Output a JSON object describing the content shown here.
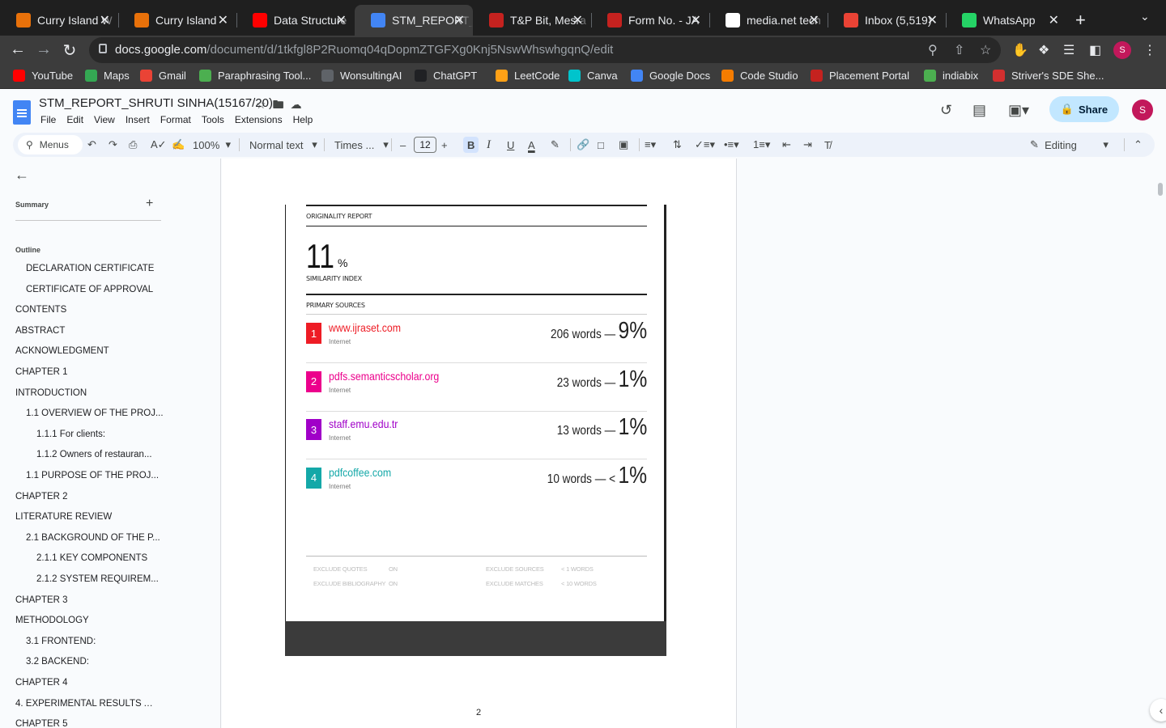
{
  "browser": {
    "tabs": [
      {
        "title": "Curry Island W",
        "favicon": "curry-icon",
        "color": "#e8710a",
        "active": false
      },
      {
        "title": "Curry Island",
        "favicon": "curry-icon",
        "color": "#e8710a",
        "active": false
      },
      {
        "title": "Data Structure",
        "favicon": "youtube-icon",
        "color": "#ff0000",
        "active": false
      },
      {
        "title": "STM_REPORT_",
        "favicon": "docs-icon",
        "color": "#4285f4",
        "active": true
      },
      {
        "title": "T&P Bit, Mesra",
        "favicon": "bit-icon",
        "color": "#c5221f",
        "active": false
      },
      {
        "title": "Form No. - JA",
        "favicon": "bit-icon",
        "color": "#c5221f",
        "active": false
      },
      {
        "title": "media.net tech",
        "favicon": "google-icon",
        "color": "#ffffff",
        "active": false
      },
      {
        "title": "Inbox (5,519)",
        "favicon": "gmail-icon",
        "color": "#ea4335",
        "active": false
      },
      {
        "title": "WhatsApp",
        "favicon": "whatsapp-icon",
        "color": "#25d366",
        "active": false
      }
    ],
    "url_host": "docs.google.com",
    "url_path": "/document/d/1tkfgl8P2Ruomq04qDopmZTGFXg0Knj5NswWhswhgqnQ/edit",
    "profile_initial": "S",
    "bookmarks": [
      {
        "label": "YouTube",
        "color": "#ff0000"
      },
      {
        "label": "Maps",
        "color": "#34a853"
      },
      {
        "label": "Gmail",
        "color": "#ea4335"
      },
      {
        "label": "Paraphrasing Tool...",
        "color": "#4caf50"
      },
      {
        "label": "WonsultingAI",
        "color": "#5f6368"
      },
      {
        "label": "ChatGPT",
        "color": "#202124"
      },
      {
        "label": "LeetCode",
        "color": "#ffa116"
      },
      {
        "label": "Canva",
        "color": "#00c4cc"
      },
      {
        "label": "Google Docs",
        "color": "#4285f4"
      },
      {
        "label": "Code Studio",
        "color": "#f57c00"
      },
      {
        "label": "Placement Portal",
        "color": "#c5221f"
      },
      {
        "label": "indiabix",
        "color": "#4caf50"
      },
      {
        "label": "Striver's SDE She...",
        "color": "#d32f2f"
      }
    ]
  },
  "docs": {
    "title": "STM_REPORT_SHRUTI SINHA(15167/20)",
    "menu": [
      "File",
      "Edit",
      "View",
      "Insert",
      "Format",
      "Tools",
      "Extensions",
      "Help"
    ],
    "share_label": "Share",
    "toolbar": {
      "search": "Menus",
      "zoom": "100%",
      "style": "Normal text",
      "font": "Times ...",
      "font_size": "12",
      "mode": "Editing"
    }
  },
  "sidebar": {
    "summary_label": "Summary",
    "outline_label": "Outline",
    "outline": [
      {
        "text": "DECLARATION CERTIFICATE",
        "level": 2
      },
      {
        "text": "CERTIFICATE OF APPROVAL",
        "level": 2
      },
      {
        "text": "CONTENTS",
        "level": 1
      },
      {
        "text": "ABSTRACT",
        "level": 1
      },
      {
        "text": "ACKNOWLEDGMENT",
        "level": 1
      },
      {
        "text": "CHAPTER 1",
        "level": 1
      },
      {
        "text": "INTRODUCTION",
        "level": 1
      },
      {
        "text": "1.1 OVERVIEW OF THE PROJ...",
        "level": 2
      },
      {
        "text": "1.1.1 For clients:",
        "level": 3
      },
      {
        "text": "1.1.2 Owners of restauran...",
        "level": 3
      },
      {
        "text": "1.1 PURPOSE OF THE PROJ...",
        "level": 2
      },
      {
        "text": "CHAPTER 2",
        "level": 1
      },
      {
        "text": "LITERATURE REVIEW",
        "level": 1
      },
      {
        "text": "2.1 BACKGROUND OF THE P...",
        "level": 2
      },
      {
        "text": "2.1.1 KEY COMPONENTS",
        "level": 3
      },
      {
        "text": "2.1.2 SYSTEM REQUIREM...",
        "level": 3
      },
      {
        "text": "CHAPTER 3",
        "level": 1
      },
      {
        "text": "METHODOLOGY",
        "level": 1
      },
      {
        "text": "3.1 FRONTEND:",
        "level": 2
      },
      {
        "text": "3.2 BACKEND:",
        "level": 2
      },
      {
        "text": "CHAPTER 4",
        "level": 1
      },
      {
        "text": "4. EXPERIMENTAL RESULTS A...",
        "level": 1
      },
      {
        "text": "CHAPTER 5",
        "level": 1
      }
    ]
  },
  "report": {
    "heading": "ORIGINALITY REPORT",
    "similarity_value": "11",
    "similarity_unit": "%",
    "similarity_label": "SIMILARITY INDEX",
    "primary_label": "PRIMARY SOURCES",
    "sources": [
      {
        "n": "1",
        "link": "www.ijraset.com",
        "kind": "Internet",
        "words": "206 words —",
        "pct": "9%",
        "color": "#ee1c25",
        "text_color": "#ee1c25"
      },
      {
        "n": "2",
        "link": "pdfs.semanticscholar.org",
        "kind": "Internet",
        "words": "23 words —",
        "pct": "1%",
        "color": "#ec008c",
        "text_color": "#ec008c"
      },
      {
        "n": "3",
        "link": "staff.emu.edu.tr",
        "kind": "Internet",
        "words": "13 words —",
        "pct": "1%",
        "color": "#a000c8",
        "text_color": "#a000c8"
      },
      {
        "n": "4",
        "link": "pdfcoffee.com",
        "kind": "Internet",
        "words": "10 words — <",
        "pct": "1%",
        "color": "#14a8a8",
        "text_color": "#14a8a8"
      }
    ],
    "exclusions": [
      {
        "label": "EXCLUDE QUOTES",
        "value": "ON"
      },
      {
        "label": "EXCLUDE BIBLIOGRAPHY",
        "value": "ON"
      },
      {
        "label": "EXCLUDE SOURCES",
        "value": "< 1 WORDS"
      },
      {
        "label": "EXCLUDE MATCHES",
        "value": "< 10 WORDS"
      }
    ],
    "page_number": "2"
  }
}
